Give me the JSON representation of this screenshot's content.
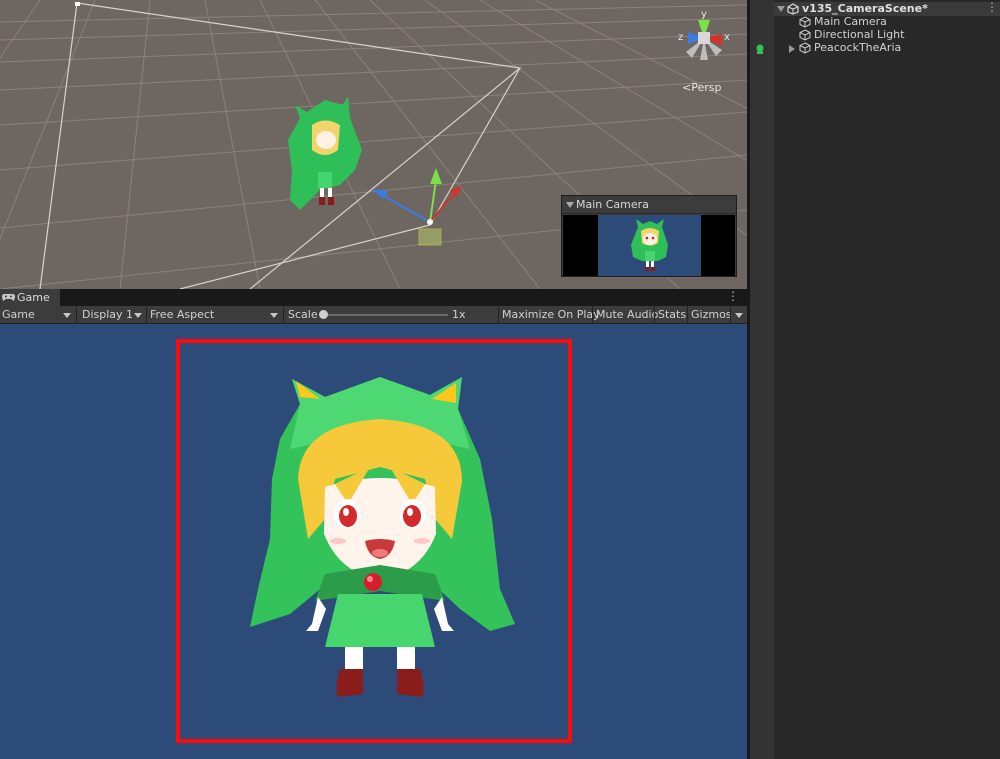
{
  "scene_view": {
    "persp_label": "Persp",
    "axes": {
      "x": "x",
      "y": "y",
      "z": "z"
    },
    "background": "#6e6660"
  },
  "camera_preview": {
    "title": "Main Camera"
  },
  "hierarchy": {
    "scene_name": "v135_CameraScene*",
    "items": [
      {
        "label": "Main Camera"
      },
      {
        "label": "Directional Light"
      },
      {
        "label": "PeacockTheAria"
      }
    ]
  },
  "game_tab": {
    "label": "Game"
  },
  "game_toolbar": {
    "view_select": "Game",
    "display_select": "Display 1",
    "aspect_select": "Free Aspect",
    "scale_label": "Scale",
    "scale_value": "1x",
    "maximize_label": "Maximize On Play",
    "mute_label": "Mute Audio",
    "stats_label": "Stats",
    "gizmos_label": "Gizmos"
  },
  "colors": {
    "game_background": "#2d4b78",
    "highlight_border": "#ff0a0a",
    "character_green": "#33c35a"
  }
}
